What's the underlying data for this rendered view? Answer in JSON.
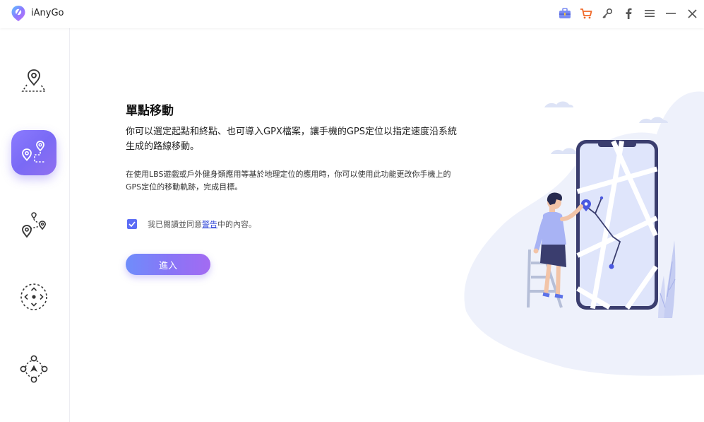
{
  "app": {
    "name": "iAnyGo"
  },
  "titlebar": {
    "icons": [
      "toolbox-icon",
      "cart-icon",
      "key-icon",
      "facebook-icon",
      "menu-icon",
      "minimize-icon",
      "close-icon"
    ]
  },
  "sidebar": {
    "items": [
      {
        "name": "change-location",
        "icon": "location-pin-icon",
        "active": false
      },
      {
        "name": "single-spot-movement",
        "icon": "two-spot-route-icon",
        "active": true
      },
      {
        "name": "multi-spot-movement",
        "icon": "multi-spot-route-icon",
        "active": false
      },
      {
        "name": "joystick-movement",
        "icon": "joystick-icon",
        "active": false
      },
      {
        "name": "gps-joystick",
        "icon": "direction-control-icon",
        "active": false
      }
    ]
  },
  "main": {
    "title": "單點移動",
    "description": "你可以選定起點和終點、也可導入GPX檔案，讓手機的GPS定位以指定速度沿系統生成的路線移動。",
    "note": "在使用LBS遊戲或戶外健身類應用等基於地理定位的應用時，你可以使用此功能更改你手機上的GPS定位的移動軌跡，完成目標。",
    "agreement": {
      "checked": true,
      "prefix": "我已閱讀並同意",
      "link": "警告",
      "suffix": "中的內容。"
    },
    "enter_label": "進入"
  },
  "colors": {
    "accent": "#7b6cf6",
    "checkbox": "#5b6cf5",
    "link": "#3348d8",
    "illustration_bg": "#eef1fb"
  }
}
